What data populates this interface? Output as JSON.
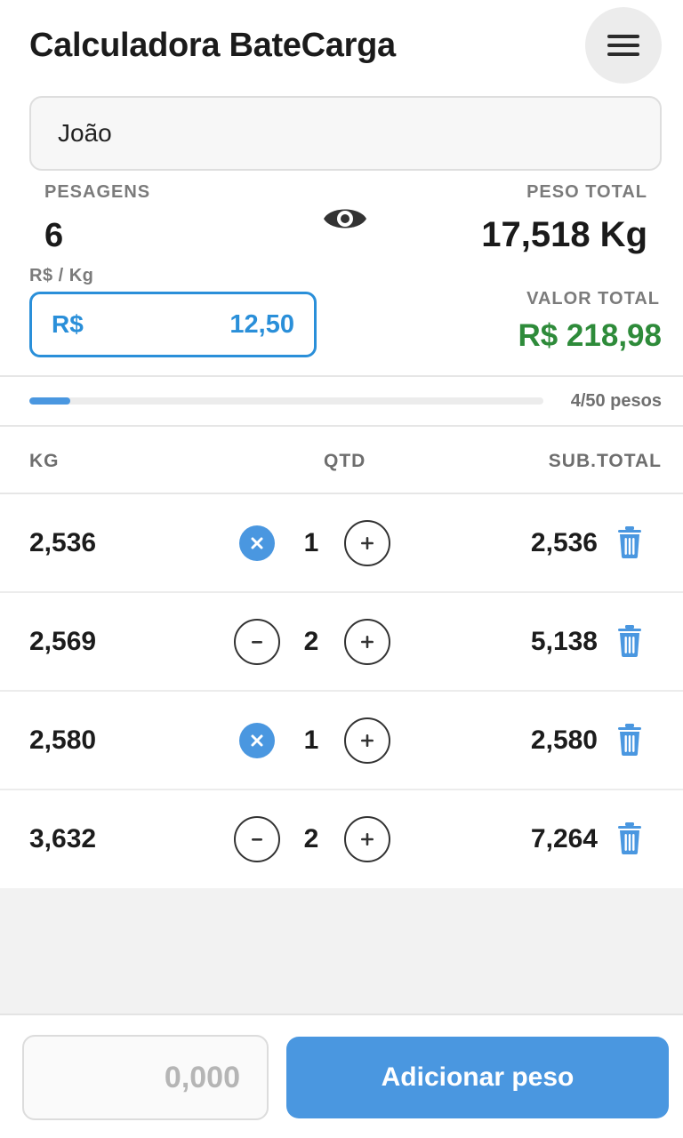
{
  "header": {
    "title": "Calculadora BateCarga"
  },
  "name_field": {
    "value": "João"
  },
  "stats": {
    "pesagens_label": "PESAGENS",
    "pesagens_value": "6",
    "peso_total_label": "PESO TOTAL",
    "peso_total_value": "17,518 Kg",
    "price_label": "R$ / Kg",
    "price_prefix": "R$",
    "price_value": "12,50",
    "valor_total_label": "VALOR TOTAL",
    "valor_total_value": "R$ 218,98"
  },
  "progress": {
    "text": "4/50 pesos",
    "fraction": 0.08
  },
  "table": {
    "headers": {
      "kg": "KG",
      "qtd": "QTD",
      "subtotal": "SUB.TOTAL"
    },
    "rows": [
      {
        "kg": "2,536",
        "qtd": "1",
        "subtotal": "2,536",
        "decrement": "remove"
      },
      {
        "kg": "2,569",
        "qtd": "2",
        "subtotal": "5,138",
        "decrement": "minus"
      },
      {
        "kg": "2,580",
        "qtd": "1",
        "subtotal": "2,580",
        "decrement": "remove"
      },
      {
        "kg": "3,632",
        "qtd": "2",
        "subtotal": "7,264",
        "decrement": "minus"
      }
    ]
  },
  "footer": {
    "weight_placeholder": "0,000",
    "add_button": "Adicionar peso"
  },
  "colors": {
    "accent": "#4a97e0",
    "total_green": "#2e8b3a",
    "price_blue": "#2a8fd9"
  },
  "icons": {
    "menu": "hamburger-icon",
    "visibility": "eye-icon",
    "remove": "close-icon",
    "decrement": "minus-icon",
    "increment": "plus-icon",
    "delete": "trash-icon"
  }
}
